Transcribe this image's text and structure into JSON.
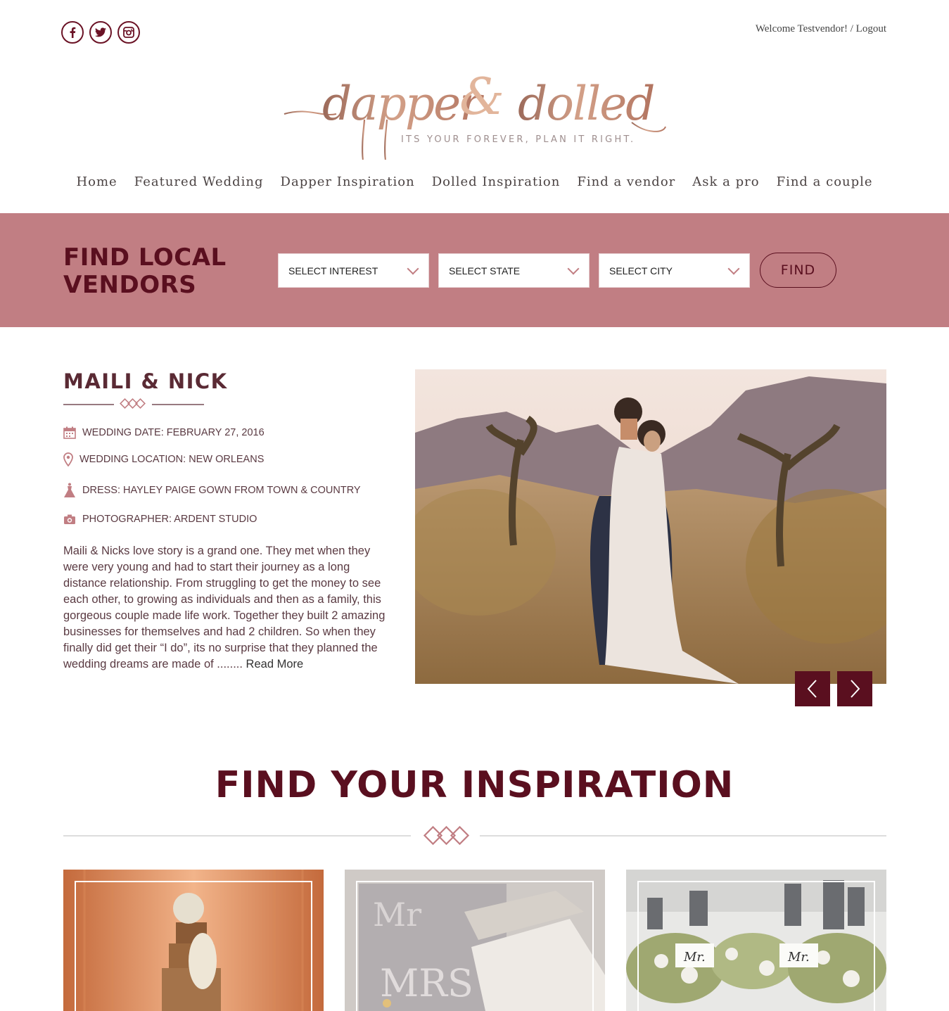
{
  "header": {
    "social": [
      {
        "icon": "facebook-icon",
        "glyph": "f"
      },
      {
        "icon": "twitter-icon",
        "glyph": "t"
      },
      {
        "icon": "instagram-icon",
        "glyph": "◎"
      }
    ],
    "welcome_text": "Welcome Testvendor!",
    "separator": " / ",
    "logout_label": "Logout",
    "logo": {
      "script_text": "dapper & dolled",
      "tagline": "ITS YOUR FOREVER, PLAN IT RIGHT."
    }
  },
  "nav": {
    "items": [
      "Home",
      "Featured Wedding",
      "Dapper Inspiration",
      "Dolled Inspiration",
      "Find a vendor",
      "Ask a pro",
      "Find a couple"
    ]
  },
  "vendor_search": {
    "title": "FIND LOCAL\nVENDORS",
    "interest_placeholder": "SELECT INTEREST",
    "state_placeholder": "SELECT STATE",
    "city_placeholder": "SELECT CITY",
    "find_label": "FIND"
  },
  "featured": {
    "couple_name": "MAILI & NICK",
    "wedding_date": "WEDDING DATE: FEBRUARY 27, 2016",
    "wedding_location": "WEDDING LOCATION: NEW ORLEANS",
    "dress": "DRESS: HAYLEY PAIGE GOWN FROM TOWN & COUNTRY",
    "photographer": "PHOTOGRAPHER: ARDENT STUDIO",
    "story": "Maili & Nicks love story is a grand one. They met when they were very young and had to start their journey as a long distance relationship. From struggling to get the money to see each other, to growing as individuals and then as a family, this gorgeous couple made life work. Together they built 2 amazing businesses for themselves and had 2 children. So when they finally did get their “I do”, its no surprise that they planned the wedding dreams are made of ........ ",
    "read_more": "Read More"
  },
  "inspiration": {
    "title": "FIND YOUR INSPIRATION"
  },
  "colors": {
    "accent": "#5a0f1f",
    "band": "#c17e83",
    "logo_rose": "#c98a6f"
  }
}
